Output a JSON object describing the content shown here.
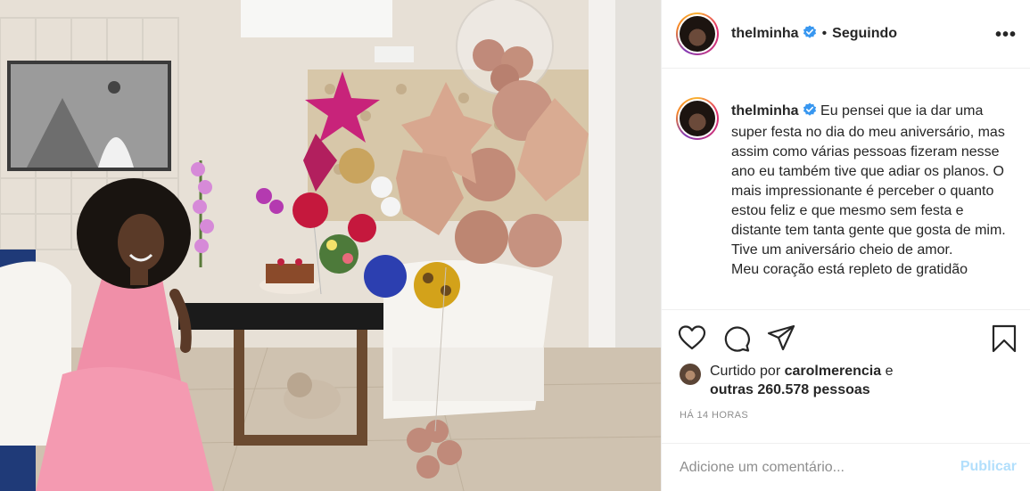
{
  "post": {
    "username": "thelminha",
    "follow_state": "Seguindo",
    "more_glyph": "•••",
    "separator": "•",
    "caption_line_1": "Eu pensei que ia dar uma super festa no dia do meu aniversário, mas assim como várias pessoas fizeram nesse ano eu também tive que adiar os planos. O mais impressionante é perceber o quanto estou feliz e que mesmo sem festa e distante tem tanta gente que gosta de mim.",
    "caption_line_2": "Tive um aniversário cheio de amor.",
    "caption_line_3": "Meu coração está repleto de gratidão",
    "liked_prefix": "Curtido por",
    "liked_user": "carolmerencia",
    "liked_conj": "e",
    "liked_others": "outras 260.578 pessoas",
    "timestamp": "HÁ 14 HORAS"
  },
  "comment": {
    "placeholder": "Adicione um comentário...",
    "publish_label": "Publicar"
  },
  "icons": {
    "verified": "verified-badge-icon",
    "like": "heart-icon",
    "comment": "comment-bubble-icon",
    "share": "paper-plane-icon",
    "save": "bookmark-icon"
  },
  "colors": {
    "verified_blue": "#3897f0",
    "publish_disabled": "#b2dffc",
    "muted_text": "#8e8e8e"
  }
}
